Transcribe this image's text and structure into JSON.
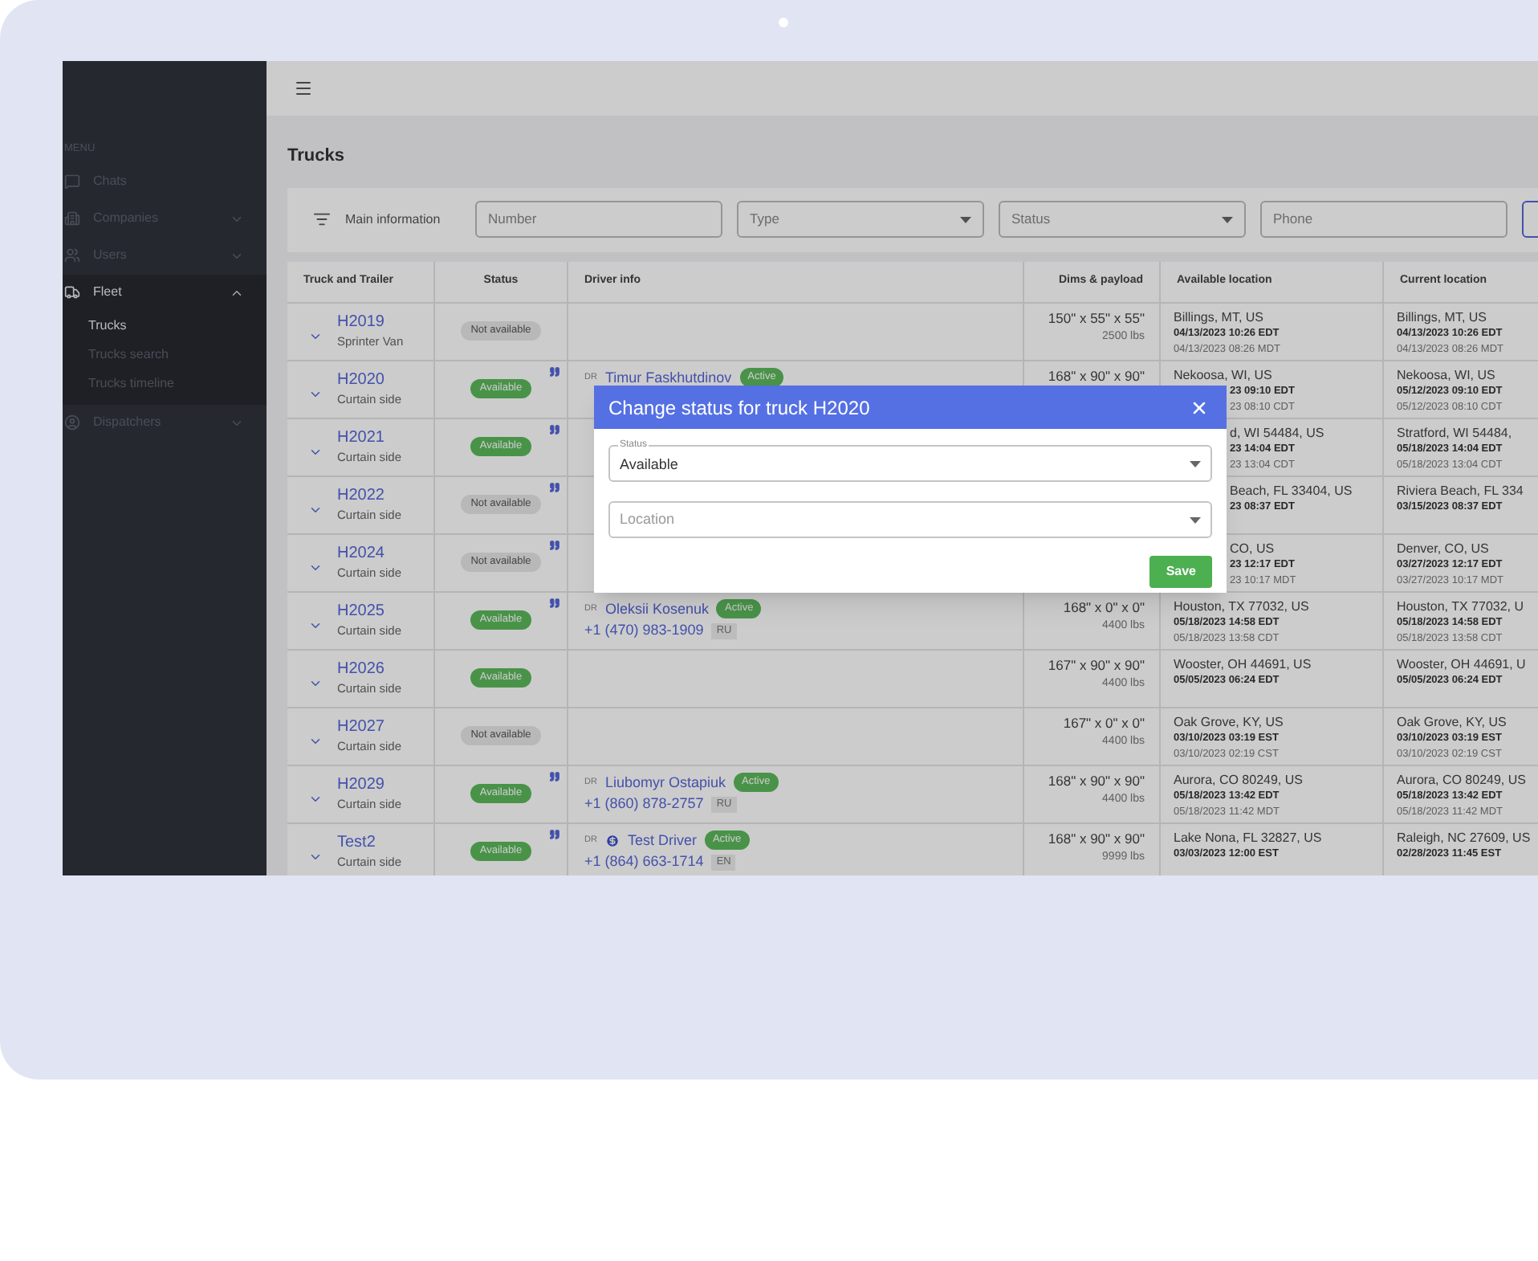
{
  "sidebar": {
    "heading": "MENU",
    "items": [
      {
        "label": "Chats"
      },
      {
        "label": "Companies",
        "expanded": false
      },
      {
        "label": "Users",
        "expanded": false
      },
      {
        "label": "Fleet",
        "expanded": true,
        "children": [
          {
            "label": "Trucks",
            "selected": true
          },
          {
            "label": "Trucks search",
            "selected": false
          },
          {
            "label": "Trucks timeline",
            "selected": false
          }
        ]
      },
      {
        "label": "Dispatchers",
        "expanded": false
      }
    ]
  },
  "page_title": "Trucks",
  "filters": {
    "label": "Main information",
    "fields": [
      {
        "placeholder": "Number",
        "kind": "text"
      },
      {
        "placeholder": "Type",
        "kind": "select"
      },
      {
        "placeholder": "Status",
        "kind": "select"
      },
      {
        "placeholder": "Phone",
        "kind": "text"
      }
    ]
  },
  "table": {
    "columns": [
      "Truck and Trailer",
      "Status",
      "Driver info",
      "Dims & payload",
      "Available location",
      "Current location"
    ],
    "rows": [
      {
        "number": "H2019",
        "type": "Sprinter Van",
        "status": {
          "label": "Not available",
          "kind": "unavailable"
        },
        "note": false,
        "dims": "150\" x 55\" x 55\"",
        "payload": "2500 lbs",
        "available": [
          "Billings, MT, US",
          "04/13/2023 10:26 EDT",
          "04/13/2023 08:26 MDT"
        ],
        "current": [
          "Billings, MT, US",
          "04/13/2023 10:26 EDT",
          "04/13/2023 08:26 MDT"
        ]
      },
      {
        "number": "H2020",
        "type": "Curtain side",
        "status": {
          "label": "Available",
          "kind": "available"
        },
        "note": true,
        "driver": {
          "badge": "DR",
          "coin": false,
          "name": "Timur Faskhutdinov",
          "state": "Active"
        },
        "dims": "168\" x 90\" x 90\"",
        "available": [
          "Nekoosa, WI, US"
        ],
        "available_tail": [
          "23 09:10 EDT",
          "23 08:10 CDT"
        ],
        "current": [
          "Nekoosa, WI, US",
          "05/12/2023 09:10 EDT",
          "05/12/2023 08:10 CDT"
        ]
      },
      {
        "number": "H2021",
        "type": "Curtain side",
        "status": {
          "label": "Available",
          "kind": "available"
        },
        "note": true,
        "available_tail": [
          "d, WI 54484, US",
          "23 14:04 EDT",
          "23 13:04 CDT"
        ],
        "current": [
          "Stratford, WI 54484,",
          "05/18/2023 14:04 EDT",
          "05/18/2023 13:04 CDT"
        ]
      },
      {
        "number": "H2022",
        "type": "Curtain side",
        "status": {
          "label": "Not available",
          "kind": "unavailable"
        },
        "note": true,
        "available_tail": [
          "Beach, FL 33404, US",
          "23 08:37 EDT"
        ],
        "current": [
          "Riviera Beach, FL 334",
          "03/15/2023 08:37 EDT"
        ]
      },
      {
        "number": "H2024",
        "type": "Curtain side",
        "status": {
          "label": "Not available",
          "kind": "unavailable"
        },
        "note": true,
        "available_tail": [
          "CO, US",
          "23 12:17 EDT",
          "23 10:17 MDT"
        ],
        "current": [
          "Denver, CO, US",
          "03/27/2023 12:17 EDT",
          "03/27/2023 10:17 MDT"
        ]
      },
      {
        "number": "H2025",
        "type": "Curtain side",
        "status": {
          "label": "Available",
          "kind": "available"
        },
        "note": true,
        "driver": {
          "badge": "DR",
          "coin": false,
          "name": "Oleksii Kosenuk",
          "state": "Active",
          "phone": "+1 (470) 983-1909",
          "lang": "RU"
        },
        "dims": "168\" x 0\" x 0\"",
        "payload": "4400 lbs",
        "available": [
          "Houston, TX 77032, US",
          "05/18/2023 14:58 EDT",
          "05/18/2023 13:58 CDT"
        ],
        "current": [
          "Houston, TX 77032, U",
          "05/18/2023 14:58 EDT",
          "05/18/2023 13:58 CDT"
        ]
      },
      {
        "number": "H2026",
        "type": "Curtain side",
        "status": {
          "label": "Available",
          "kind": "available"
        },
        "note": false,
        "dims": "167\" x 90\" x 90\"",
        "payload": "4400 lbs",
        "available": [
          "Wooster, OH 44691, US",
          "05/05/2023 06:24 EDT"
        ],
        "current": [
          "Wooster, OH 44691, U",
          "05/05/2023 06:24 EDT"
        ]
      },
      {
        "number": "H2027",
        "type": "Curtain side",
        "status": {
          "label": "Not available",
          "kind": "unavailable"
        },
        "note": false,
        "dims": "167\" x 0\" x 0\"",
        "payload": "4400 lbs",
        "available": [
          "Oak Grove, KY, US",
          "03/10/2023 03:19 EST",
          "03/10/2023 02:19 CST"
        ],
        "current": [
          "Oak Grove, KY, US",
          "03/10/2023 03:19 EST",
          "03/10/2023 02:19 CST"
        ]
      },
      {
        "number": "H2029",
        "type": "Curtain side",
        "status": {
          "label": "Available",
          "kind": "available"
        },
        "note": true,
        "driver": {
          "badge": "DR",
          "coin": false,
          "name": "Liubomyr Ostapiuk",
          "state": "Active",
          "phone": "+1 (860) 878-2757",
          "lang": "RU"
        },
        "dims": "168\" x 90\" x 90\"",
        "payload": "4400 lbs",
        "available": [
          "Aurora, CO 80249, US",
          "05/18/2023 13:42 EDT",
          "05/18/2023 11:42 MDT"
        ],
        "current": [
          "Aurora, CO 80249, US",
          "05/18/2023 13:42 EDT",
          "05/18/2023 11:42 MDT"
        ]
      },
      {
        "number": "Test2",
        "type": "Curtain side",
        "status": {
          "label": "Available",
          "kind": "available"
        },
        "note": true,
        "driver": {
          "badge": "DR",
          "coin": true,
          "name": "Test Driver",
          "state": "Active",
          "phone": "+1 (864) 663-1714",
          "lang": "EN"
        },
        "dims": "168\" x 90\" x 90\"",
        "payload": "9999 lbs",
        "available": [
          "Lake Nona, FL 32827, US",
          "03/03/2023 12:00 EST"
        ],
        "current": [
          "Raleigh, NC 27609, US",
          "02/28/2023 11:45 EST"
        ]
      }
    ]
  },
  "dialog": {
    "title": "Change status for truck H2020",
    "fields": [
      {
        "label": "Status",
        "value": "Available"
      },
      {
        "placeholder": "Location"
      }
    ],
    "button": "Save"
  }
}
